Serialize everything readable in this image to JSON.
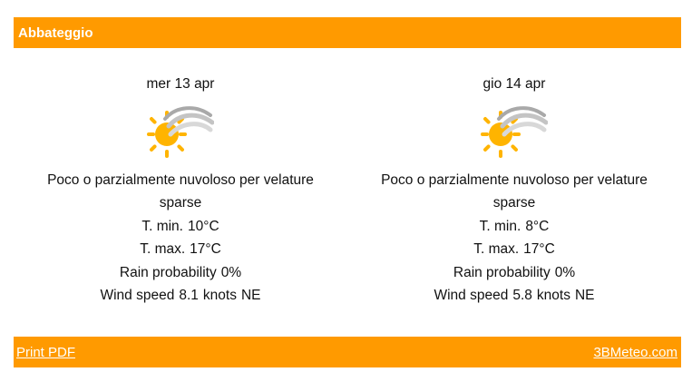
{
  "header": {
    "location": "Abbateggio"
  },
  "days": [
    {
      "day": "mer 13 apr",
      "icon": "partly-cloudy-sun-icon",
      "description": "Poco o parzialmente nuvoloso per velature sparse",
      "tmin_label": "T. min.",
      "tmin_value": "10°C",
      "tmax_label": "T. max.",
      "tmax_value": "17°C",
      "rain_label": "Rain probability",
      "rain_value": "0%",
      "wind_label": "Wind speed",
      "wind_value": "8.1",
      "wind_unit": "knots",
      "wind_dir": "NE"
    },
    {
      "day": "gio 14 apr",
      "icon": "partly-cloudy-sun-icon",
      "description": "Poco o parzialmente nuvoloso per velature sparse",
      "tmin_label": "T. min.",
      "tmin_value": "8°C",
      "tmax_label": "T. max.",
      "tmax_value": "17°C",
      "rain_label": "Rain probability",
      "rain_value": "0%",
      "wind_label": "Wind speed",
      "wind_value": "5.8",
      "wind_unit": "knots",
      "wind_dir": "NE"
    }
  ],
  "footer": {
    "print_label": "Print PDF",
    "source_label": "3BMeteo.com"
  },
  "colors": {
    "accent": "#ff9a00",
    "sun": "#ffb400",
    "cloud": "#b8b8b8"
  }
}
